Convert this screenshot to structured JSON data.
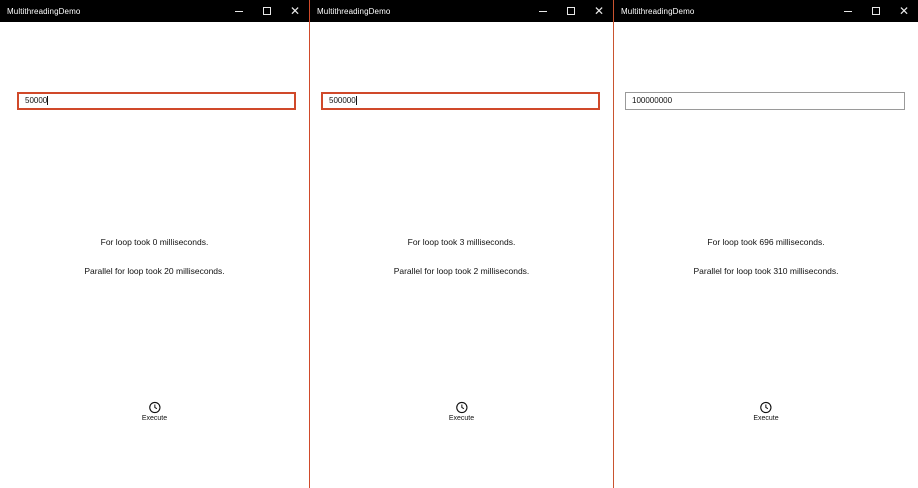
{
  "windows": [
    {
      "title": "MultithreadingDemo",
      "input_value": "50000",
      "for_loop_text": "For loop took 0 milliseconds.",
      "parallel_text": "Parallel for loop took 20 milliseconds.",
      "execute_label": "Execute"
    },
    {
      "title": "MultithreadingDemo",
      "input_value": "500000",
      "for_loop_text": "For loop took 3 milliseconds.",
      "parallel_text": "Parallel for loop took 2 milliseconds.",
      "execute_label": "Execute"
    },
    {
      "title": "MultithreadingDemo",
      "input_value": "100000000",
      "for_loop_text": "For loop took 696 milliseconds.",
      "parallel_text": "Parallel for loop took 310 milliseconds.",
      "execute_label": "Execute"
    }
  ],
  "icons": {
    "minimize": "minimize-icon",
    "maximize": "maximize-icon",
    "close": "close-icon",
    "execute": "clock-icon",
    "close_glyph": "✕"
  },
  "colors": {
    "titlebar": "#000000",
    "focus_border": "#d0492a",
    "window_divider": "#d04a2a",
    "unfocused_border": "#9a9a9a"
  }
}
